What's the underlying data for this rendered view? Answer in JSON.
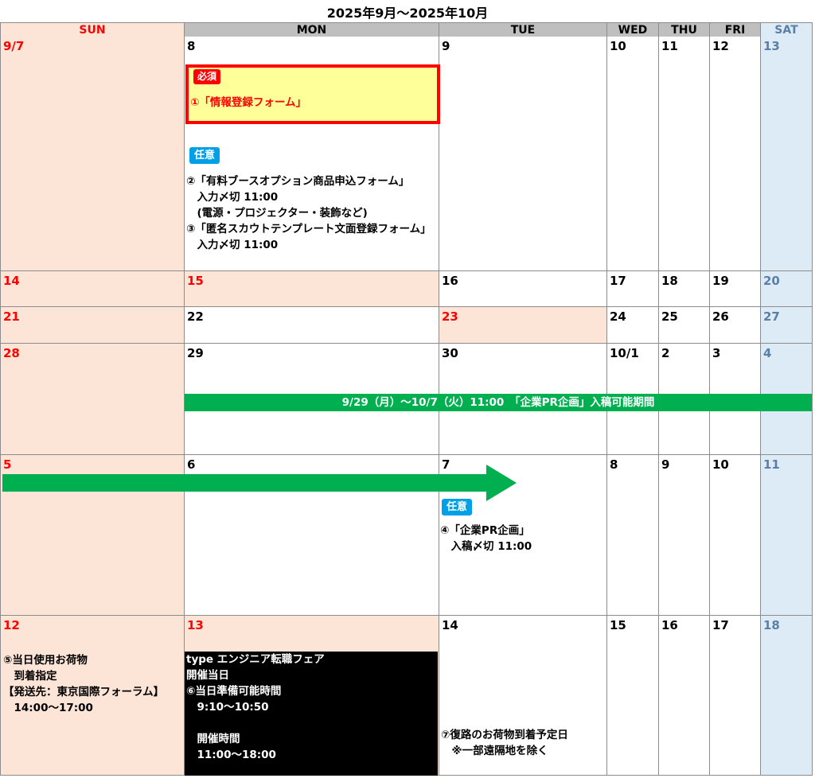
{
  "title": "2025年9月～2025年10月",
  "headers": [
    "SUN",
    "MON",
    "TUE",
    "WED",
    "THU",
    "FRI",
    "SAT"
  ],
  "weeks": [
    [
      "9/7",
      "8",
      "9",
      "10",
      "11",
      "12",
      "13"
    ],
    [
      "14",
      "15",
      "16",
      "17",
      "18",
      "19",
      "20"
    ],
    [
      "21",
      "22",
      "23",
      "24",
      "25",
      "26",
      "27"
    ],
    [
      "28",
      "29",
      "30",
      "10/1",
      "2",
      "3",
      "4"
    ],
    [
      "5",
      "6",
      "7",
      "8",
      "9",
      "10",
      "11"
    ],
    [
      "12",
      "13",
      "14",
      "15",
      "16",
      "17",
      "18"
    ]
  ],
  "events": {
    "required_tag": "必須",
    "required_text": "①「情報登録フォーム」",
    "optional_tag": "任意",
    "booth_lines": "②「有料ブースオプション商品申込フォーム」\n　入力〆切 11:00\n　(電源・プロジェクター・装飾など)\n③「匿名スカウトテンプレート文面登録フォーム」\n　入力〆切 11:00",
    "pr_band": "9/29（月）～10/7（火）11:00　「企業PR企画」入稿可能期間",
    "pr_tag": "任意",
    "pr_lines": "④「企業PR企画」\n　入稿〆切 11:00",
    "luggage_lines": "⑤当日使用お荷物\n　到着指定\n【発送先：東京国際フォーラム】\n　14:00～17:00",
    "fair_lines": "type エンジニア転職フェア\n開催当日\n⑥当日準備可能時間\n　9:10～10:50\n\n　開催時間\n　11:00～18:00",
    "return_lines": "⑦復路のお荷物到着予定日\n　※一部遠隔地を除く"
  },
  "colors": {
    "sunday_bg": "#fce4d6",
    "saturday_bg": "#ddebf7",
    "header_bg": "#bfbfbf",
    "band_green": "#00b050",
    "required_red": "#ff0000",
    "required_fill": "#ffff99",
    "optional_blue": "#00a0e9",
    "fair_black": "#000000"
  }
}
